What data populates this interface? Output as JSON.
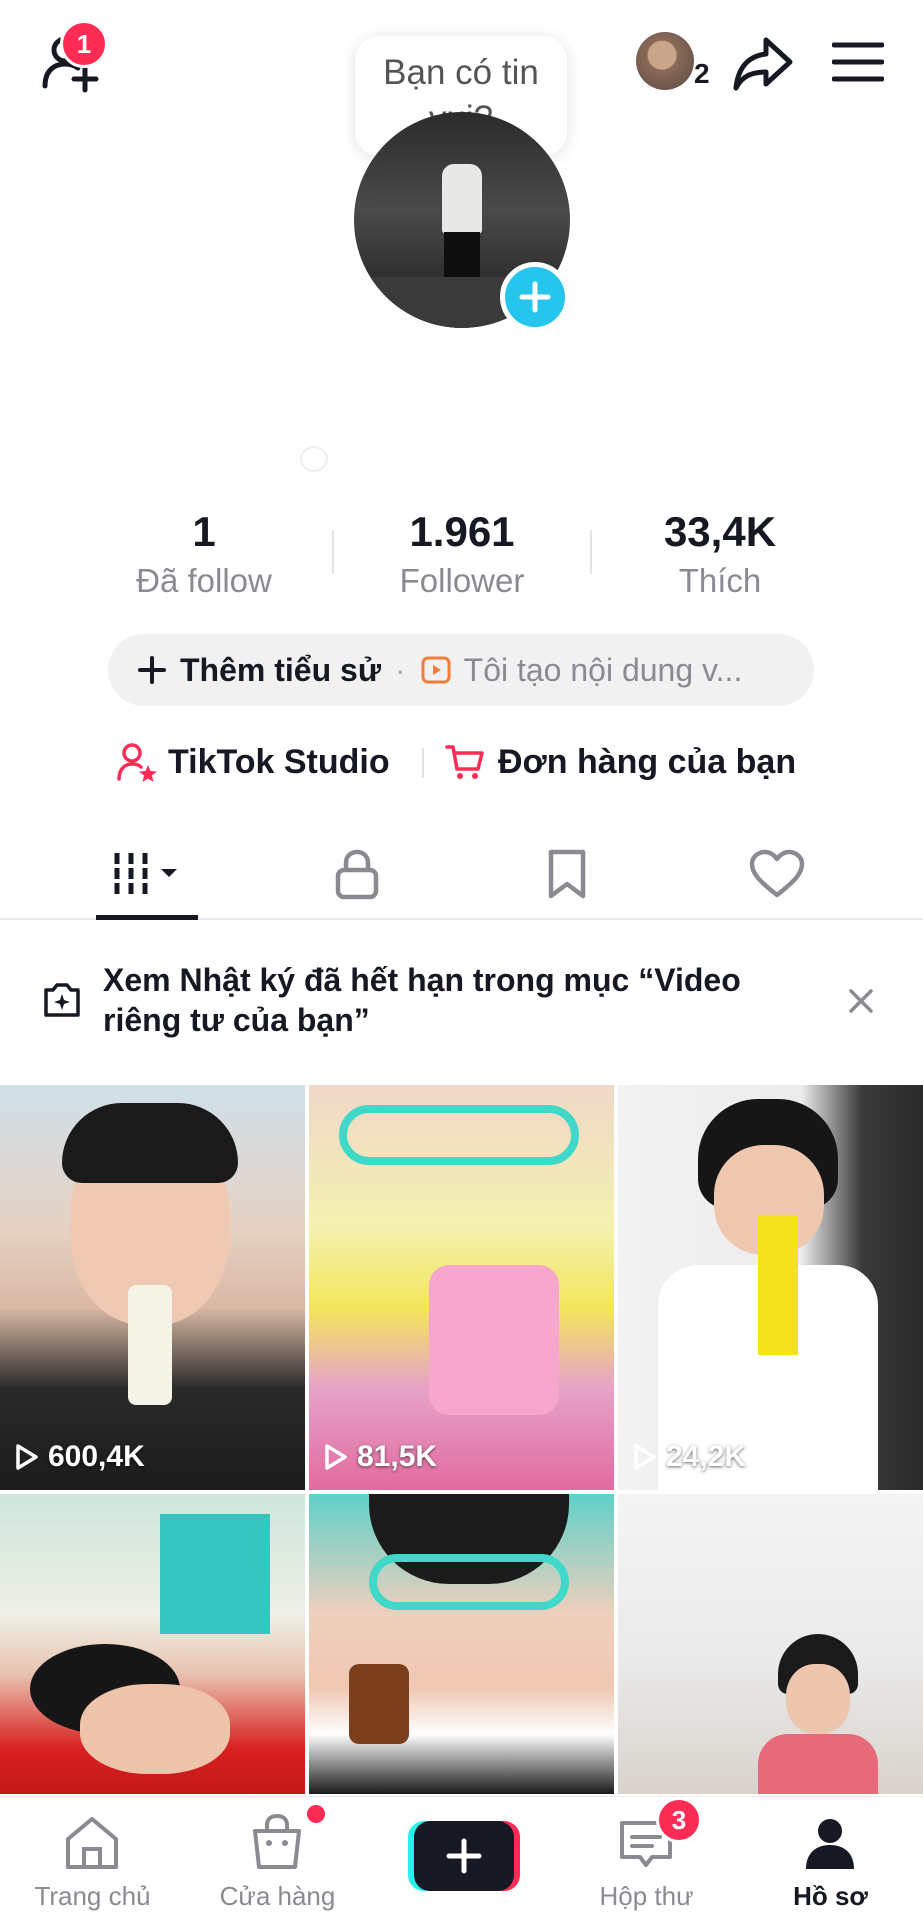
{
  "header": {
    "follow_requests_badge": "1",
    "story_bubble_text": "Bạn có tin vui?",
    "viewers_count": "2"
  },
  "stats": {
    "following_count": "1",
    "following_label": "Đã follow",
    "followers_count": "1.961",
    "followers_label": "Follower",
    "likes_count": "33,4K",
    "likes_label": "Thích"
  },
  "bio": {
    "add_bio_label": "Thêm tiểu sử",
    "creator_text": "Tôi tạo nội dung v..."
  },
  "links": {
    "studio_label": "TikTok Studio",
    "orders_label": "Đơn hàng của bạn"
  },
  "notice": {
    "text_line1": "Xem Nhật ký đã hết hạn trong mục “Video",
    "text_line2": "riêng tư của bạn”"
  },
  "videos": [
    {
      "views": "600,4K"
    },
    {
      "views": "81,5K"
    },
    {
      "views": "24,2K"
    },
    {
      "views": ""
    },
    {
      "views": ""
    },
    {
      "views": ""
    }
  ],
  "nav": {
    "home_label": "Trang chủ",
    "shop_label": "Cửa hàng",
    "inbox_label": "Hộp thư",
    "inbox_badge": "3",
    "profile_label": "Hồ sơ"
  },
  "colors": {
    "accent_red": "#fe2c55",
    "accent_cyan": "#25c5ee",
    "orange": "#f27d3a"
  }
}
